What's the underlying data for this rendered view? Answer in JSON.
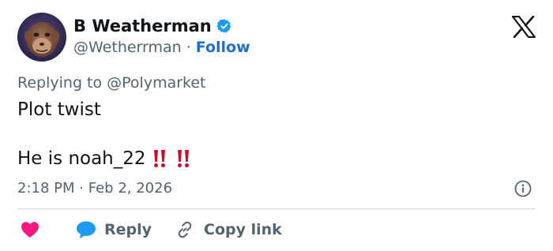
{
  "author": {
    "display_name": "B Weatherman",
    "handle": "@Wetherrman",
    "separator": "·",
    "follow_label": "Follow",
    "avatar_icon": "ape-avatar",
    "verified_icon": "verified-badge-icon",
    "verified_color": "#1d9bf0"
  },
  "platform_icon": "x-logo-icon",
  "reply_context": {
    "prefix": "Replying to ",
    "mention": "@Polymarket"
  },
  "tweet": {
    "line1": "Plot twist",
    "line2": "He is noah_22",
    "emoji": [
      "double-exclamation-icon",
      "double-exclamation-icon"
    ],
    "emoji_color": "#c8102e"
  },
  "meta": {
    "time": "2:18 PM",
    "separator": "·",
    "date": "Feb 2, 2026",
    "info_icon": "info-icon"
  },
  "actions": {
    "like_icon": "heart-icon",
    "like_color": "#f91880",
    "reply_label": "Reply",
    "reply_icon": "speech-bubble-icon",
    "reply_color": "#1d9bf0",
    "copy_label": "Copy link",
    "copy_icon": "link-icon"
  }
}
